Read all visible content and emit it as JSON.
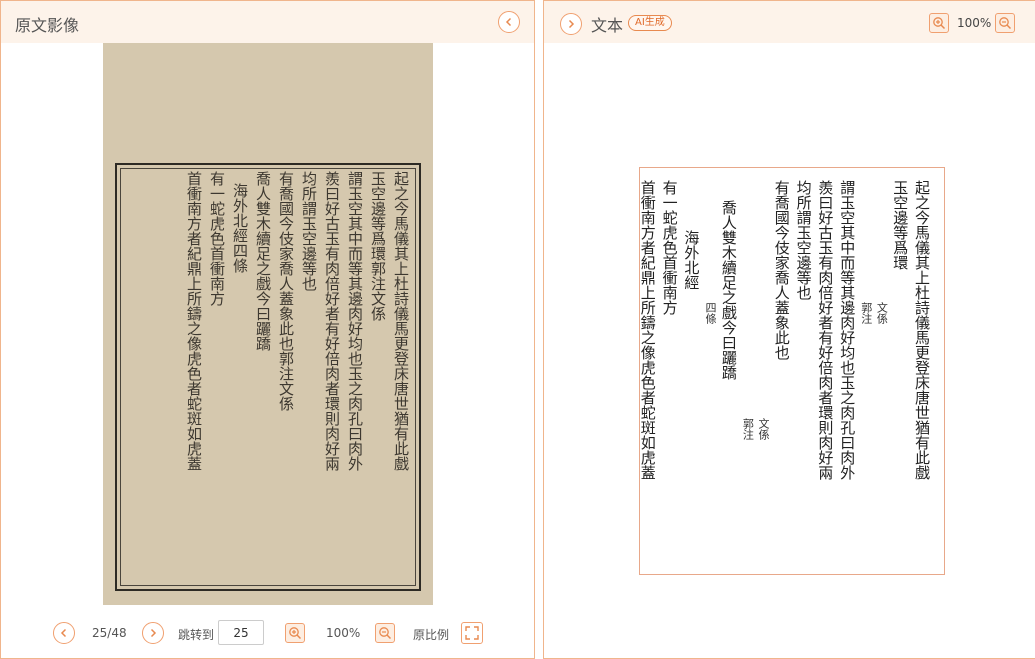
{
  "left_panel": {
    "title": "原文影像",
    "nav": {
      "page_indicator": "25/48",
      "jump_label": "跳转到",
      "page_input": "25",
      "zoom": "100%",
      "original_ratio": "原比例"
    },
    "scan_columns": [
      "起之今馬儀其上杜詩儀馬更登床唐世猶有此戲",
      "玉空邊等爲環郭注文係",
      "謂玉空其中而等其邊肉好均也玉之肉孔曰肉外",
      "羨曰好古玉有肉倍好者有好倍肉者環則肉好兩",
      "均所謂玉空邊等也",
      "有喬國今伎家喬人蓋象此也郭注文係",
      "喬人雙木續足之戲今曰躧蹻",
      "海外北經四條",
      "有一蛇虎色首衝南方",
      "首衝南方者紀鼎上所鑄之像虎色者蛇斑如虎蓋"
    ]
  },
  "right_panel": {
    "title": "文本",
    "ai_badge": "AI生成",
    "zoom": "100%",
    "text_columns": [
      {
        "text": "起之今馬儀其上杜詩儀馬更登床唐世猶有此戲",
        "style": "main"
      },
      {
        "text": "玉空邊等爲環",
        "style": "main"
      },
      {
        "text": "文係",
        "style": "small-a"
      },
      {
        "text": "郭注",
        "style": "small-a"
      },
      {
        "text": "謂玉空其中而等其邊肉好均也玉之肉孔曰肉外",
        "style": "main"
      },
      {
        "text": "羨曰好古玉有肉倍好者有好倍肉者環則肉好兩",
        "style": "main"
      },
      {
        "text": "均所謂玉空邊等也",
        "style": "main"
      },
      {
        "text": "有喬國今伎家喬人蓋象此也",
        "style": "main"
      },
      {
        "text": "文係",
        "style": "small-b"
      },
      {
        "text": "郭注",
        "style": "small-b"
      },
      {
        "text": "喬人雙木續足之戲今曰躧蹻",
        "style": "main"
      },
      {
        "text": "四條",
        "style": "small-c"
      },
      {
        "text": "海外北經",
        "style": "main-indent"
      },
      {
        "text": "有一蛇虎色首衝南方",
        "style": "main"
      },
      {
        "text": "首衝南方者紀鼎上所鑄之像虎色者蛇斑如虎蓋",
        "style": "main"
      }
    ]
  },
  "colors": {
    "accent": "#e88a50",
    "border": "#f0b58c",
    "header_bg": "#fdf3ea",
    "scan_paper": "#d5c8ae"
  },
  "icons": [
    "chevron-left-icon",
    "chevron-right-icon",
    "zoom-in-icon",
    "zoom-out-icon",
    "fullscreen-icon"
  ]
}
